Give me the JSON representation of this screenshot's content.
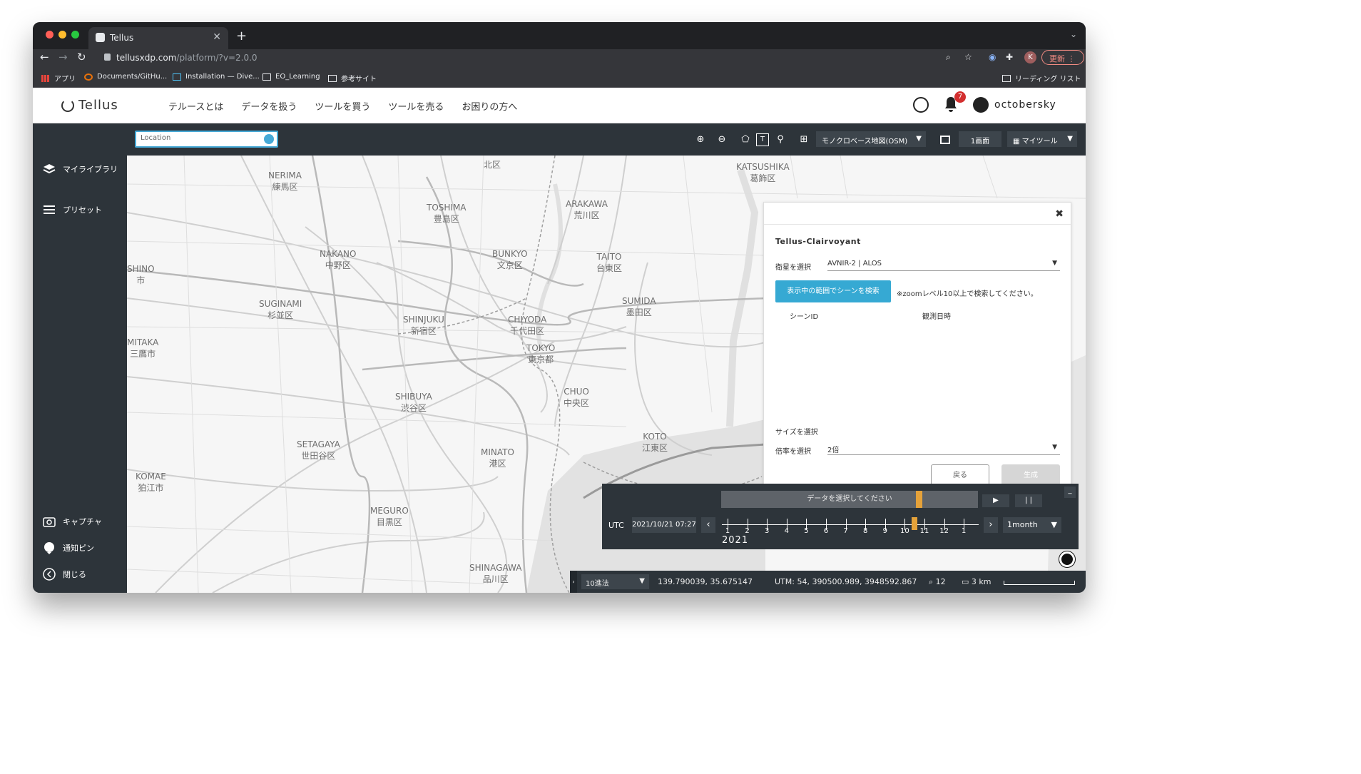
{
  "browser": {
    "tab_title": "Tellus",
    "url_host": "tellusxdp.com",
    "url_path": "/platform/?v=2.0.0",
    "profile_initial": "K",
    "update_label": "更新"
  },
  "bookmarks": {
    "items": [
      "アプリ",
      "Documents/GitHu...",
      "Installation — Dive...",
      "EO_Learning",
      "参考サイト"
    ],
    "reading_list": "リーディング リスト"
  },
  "header": {
    "logo": "Tellus",
    "nav": [
      "テルースとは",
      "データを扱う",
      "ツールを買う",
      "ツールを売る",
      "お困りの方へ"
    ],
    "notification_count": "7",
    "username": "octobersky"
  },
  "sidebar": {
    "top_items": [
      "マイライブラリ",
      "プリセット"
    ],
    "bottom_items": [
      "キャプチャ",
      "通知ピン",
      "閉じる"
    ]
  },
  "mapbar": {
    "search_placeholder": "Location",
    "basemap": "モノクロベース地図(OSM)",
    "screens": "1画面",
    "mytools": "マイツール"
  },
  "map": {
    "labels": [
      {
        "en": "NERIMA",
        "jp": "練馬区"
      },
      {
        "en": "TOSHIMA",
        "jp": "豊島区"
      },
      {
        "en": "ARAKAWA",
        "jp": "荒川区"
      },
      {
        "en": "NAKANO",
        "jp": "中野区"
      },
      {
        "en": "BUNKYO",
        "jp": "文京区"
      },
      {
        "en": "TAITO",
        "jp": "台東区"
      },
      {
        "en": "SUGINAMI",
        "jp": "杉並区"
      },
      {
        "en": "SHINJUKU",
        "jp": "新宿区"
      },
      {
        "en": "CHIYODA",
        "jp": "千代田区"
      },
      {
        "en": "SUMIDA",
        "jp": "墨田区"
      },
      {
        "en": "TOKYO",
        "jp": "東京都"
      },
      {
        "en": "MITAKA",
        "jp": "三鷹市"
      },
      {
        "en": "SHIBUYA",
        "jp": "渋谷区"
      },
      {
        "en": "CHUO",
        "jp": "中央区"
      },
      {
        "en": "SETAGAYA",
        "jp": "世田谷区"
      },
      {
        "en": "MINATO",
        "jp": "港区"
      },
      {
        "en": "KOTO",
        "jp": "江東区"
      },
      {
        "en": "KOMAE",
        "jp": "狛江市"
      },
      {
        "en": "MEGURO",
        "jp": "目黒区"
      },
      {
        "en": "SHINAGAWA",
        "jp": "品川区"
      },
      {
        "en": "KATSUSHIKA",
        "jp": "葛飾区"
      },
      {
        "en": "SHINO",
        "jp": "市"
      },
      {
        "en": "",
        "jp": "北区"
      }
    ]
  },
  "panel": {
    "title": "Tellus-Clairvoyant",
    "satellite_label": "衛星を選択",
    "satellite_value": "AVNIR-2 | ALOS",
    "search_button": "表示中の範囲でシーンを検索",
    "note": "※zoomレベル10以上で検索してください。",
    "col_scene": "シーンID",
    "col_date": "観測日時",
    "size_label": "サイズを選択",
    "scale_label": "倍率を選択",
    "scale_value": "2倍",
    "back_button": "戻る",
    "generate_button": "生成"
  },
  "timeline": {
    "bar_text": "データを選択してください",
    "play": "▶",
    "pause": "| |",
    "utc_label": "UTC",
    "datetime": "2021/10/21 07:27",
    "months": [
      "1",
      "2",
      "3",
      "4",
      "5",
      "6",
      "7",
      "8",
      "9",
      "10",
      "11",
      "12",
      "1"
    ],
    "selected_month_index": 9.5,
    "year": "2021",
    "interval": "1month"
  },
  "statusbar": {
    "number_format": "10進法",
    "coords": "139.790039, 35.675147",
    "utm": "UTM: 54, 390500.989, 3948592.867",
    "zoom": "12",
    "scale": "3 km"
  },
  "colors": {
    "accent": "#36a9d3",
    "dark_ui": "#2d343a",
    "timeline_marker": "#e5a23a",
    "badge": "#d32f2f"
  }
}
